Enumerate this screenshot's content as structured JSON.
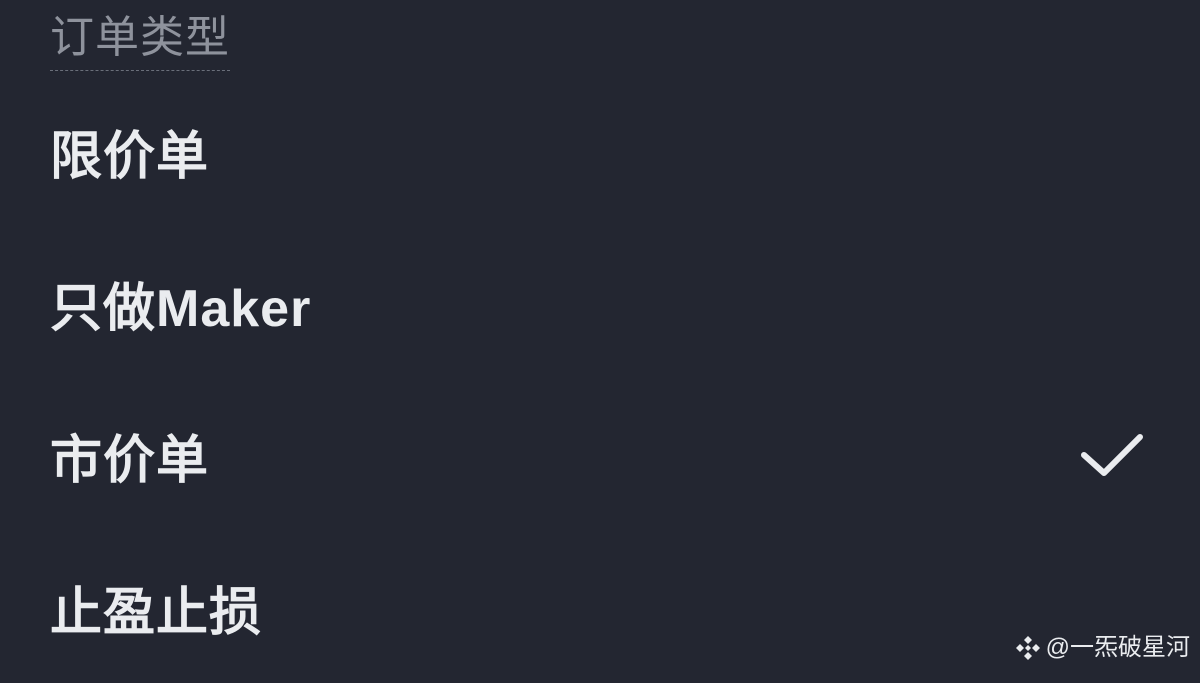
{
  "section": {
    "title": "订单类型"
  },
  "options": [
    {
      "label": "限价单",
      "selected": false
    },
    {
      "label": "只做Maker",
      "selected": false
    },
    {
      "label": "市价单",
      "selected": true
    },
    {
      "label": "止盈止损",
      "selected": false
    }
  ],
  "check_icon": "checkmark-icon",
  "watermark": {
    "logo_icon": "binance-logo-icon",
    "text": "@一炁破星河"
  },
  "colors": {
    "background": "#232631",
    "header_text": "#8e929c",
    "option_text": "#eaecef",
    "check": "#eaecef"
  }
}
